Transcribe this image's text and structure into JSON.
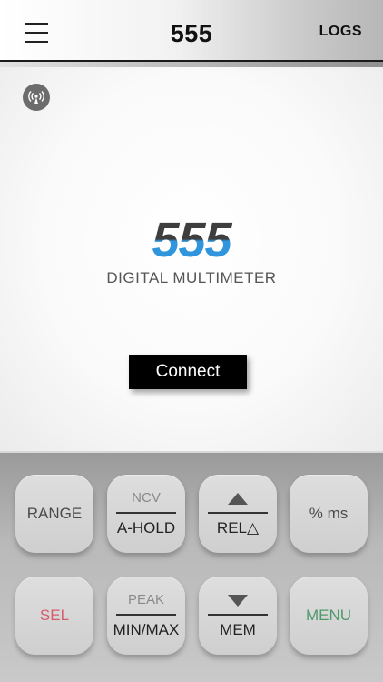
{
  "header": {
    "title": "555",
    "logs_label": "LOGS",
    "menu_icon": "hamburger-menu-icon"
  },
  "main": {
    "bluetooth_icon": "bluetooth-broadcast-icon",
    "logo_number": "555",
    "logo_subtitle": "DIGITAL MULTIMETER",
    "connect_label": "Connect",
    "logo_colors": {
      "dark": "#3e3e3e",
      "blue": "#2f95dc"
    }
  },
  "keypad": {
    "range": "RANGE",
    "ncv": "NCV",
    "a_hold": "A-HOLD",
    "rel": "REL△",
    "percent_ms": "% ms",
    "sel": "SEL",
    "peak": "PEAK",
    "min_max": "MIN/MAX",
    "mem": "MEM",
    "menu": "MENU",
    "colors": {
      "sel": "#d45c6a",
      "menu": "#4f9a6a"
    }
  }
}
